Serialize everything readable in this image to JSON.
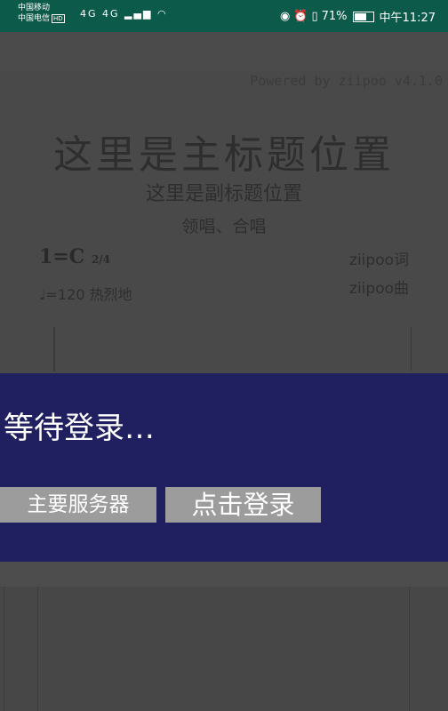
{
  "status_bar": {
    "carrier1": "中国移动",
    "carrier2": "中国电信",
    "hd_badge": "HD",
    "signal_labels": "4G 4G",
    "battery_percent": "71%",
    "time": "中午11:27"
  },
  "sheet": {
    "powered_by": "Powered by ziipoo v4.1.0",
    "main_title": "这里是主标题位置",
    "sub_title": "这里是副标题位置",
    "singers": "领唱、合唱",
    "key_signature": "1=C",
    "time_signature": "2/4",
    "lyricist": "ziipoo词",
    "composer": "ziipoo曲",
    "tempo": "♩=120 热烈地"
  },
  "dialog": {
    "message": "等待登录…",
    "server_button": "主要服务器",
    "login_button": "点击登录"
  },
  "colors": {
    "status_bar": "#0c5a4a",
    "dialog_bg": "#201f5f",
    "button_bg": "#9c9c9c",
    "overlay_bg": "#464646"
  }
}
